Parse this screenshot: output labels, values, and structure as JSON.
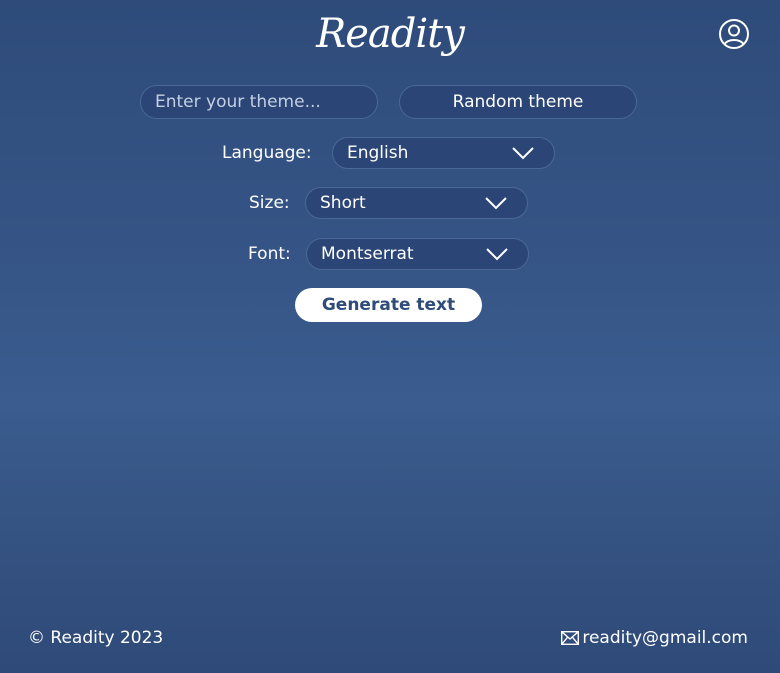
{
  "header": {
    "logo": "Readity",
    "account_icon": "user-circle-icon"
  },
  "theme": {
    "placeholder": "Enter your theme...",
    "random_label": "Random theme"
  },
  "options": {
    "language": {
      "label": "Language:",
      "value": "English"
    },
    "size": {
      "label": "Size:",
      "value": "Short"
    },
    "font": {
      "label": "Font:",
      "value": "Montserrat"
    }
  },
  "generate_label": "Generate text",
  "footer": {
    "copyright": "© Readity 2023",
    "email": "readity@gmail.com",
    "email_icon": "mail-icon"
  },
  "colors": {
    "background": "#355485",
    "field": "#2b4676",
    "button_text": "#2e4b7a"
  }
}
